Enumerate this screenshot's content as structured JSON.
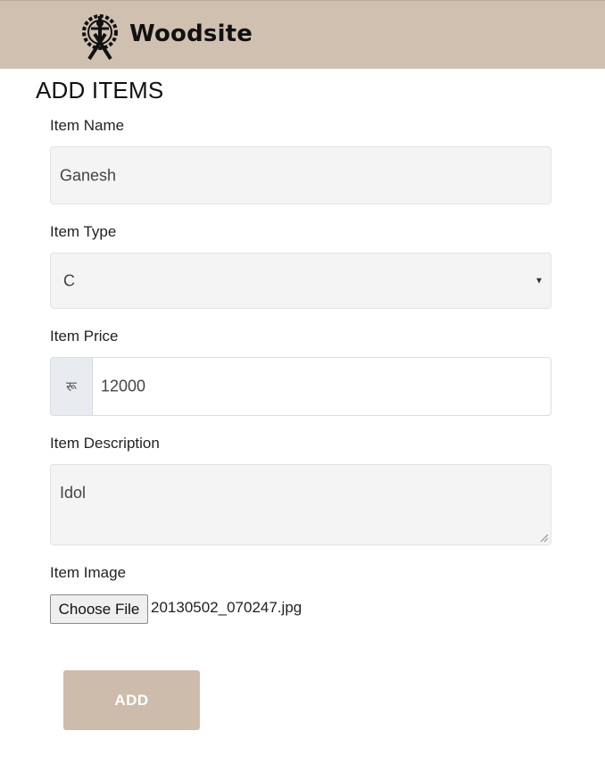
{
  "header": {
    "brand": "Woodsite",
    "logo_icon": "woodcraft-logo-icon",
    "background": "#d0c0b0"
  },
  "page_title": "ADD ITEMS",
  "form": {
    "item_name": {
      "label": "Item Name",
      "value": "Ganesh"
    },
    "item_type": {
      "label": "Item Type",
      "selected": "C"
    },
    "item_price": {
      "label": "Item Price",
      "currency_symbol": "रू",
      "value": "12000"
    },
    "item_description": {
      "label": "Item Description",
      "value": "Idol"
    },
    "item_image": {
      "label": "Item Image",
      "button_label": "Choose File",
      "file_name": "20130502_070247.jpg"
    },
    "submit_label": "ADD"
  },
  "colors": {
    "accent": "#cdbcab",
    "field_bg": "#f4f4f4"
  }
}
